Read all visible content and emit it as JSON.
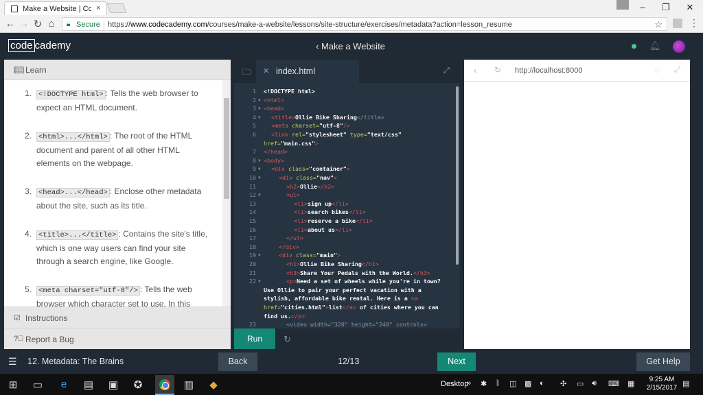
{
  "browser": {
    "tab_title": "Make a Website | Codecademy",
    "tab_close": "×",
    "secure_label": "Secure",
    "url_prefix": "https://",
    "url_host": "www.codecademy.com",
    "url_path": "/courses/make-a-website/lessons/site-structure/exercises/metadata?action=lesson_resume",
    "window_minimize": "–",
    "window_restore": "❐",
    "window_close": "✕"
  },
  "header": {
    "logo_box": "code",
    "logo_rest": "cademy",
    "course_title": "‹ Make a Website"
  },
  "learn": {
    "title": "Learn",
    "items": [
      {
        "num": "1.",
        "code": "<!DOCTYPE html>",
        "text": ": Tells the web browser to expect an HTML document."
      },
      {
        "num": "2.",
        "code": "<html>...</html>",
        "text": ": The root of the HTML document and parent of all other HTML elements on the webpage."
      },
      {
        "num": "3.",
        "code": "<head>...</head>",
        "text": ": Enclose other metadata about the site, such as its title."
      },
      {
        "num": "4.",
        "code": "<title>...</title>",
        "text": ": Contains the site's title, which is one way users can find your site through a search engine, like Google."
      },
      {
        "num": "5.",
        "code": "<meta charset=\"utf-8\"/>",
        "text": ": Tells the web browser which character set to use. In this"
      }
    ],
    "instructions_label": "Instructions",
    "report_label": "Report a Bug"
  },
  "editor": {
    "file_name": "index.html",
    "run_label": "Run",
    "line_numbers": [
      "1",
      "2",
      "3",
      "4",
      "5",
      "6",
      "",
      "7",
      "8",
      "9",
      "10",
      "11",
      "12",
      "13",
      "14",
      "15",
      "16",
      "17",
      "18",
      "19",
      "20",
      "21",
      "22",
      "",
      "",
      "",
      "",
      "23"
    ]
  },
  "preview": {
    "url": "http://localhost:8000"
  },
  "bottom_nav": {
    "lesson_name": "12. Metadata: The Brains",
    "back_label": "Back",
    "progress": "12/13",
    "next_label": "Next",
    "help_label": "Get Help"
  },
  "taskbar": {
    "desktop_label": "Desktop",
    "time": "9:25 AM",
    "date": "2/15/2017"
  }
}
